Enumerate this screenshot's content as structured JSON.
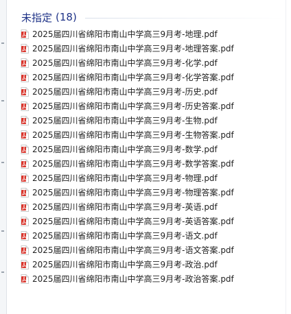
{
  "group": {
    "title": "未指定",
    "count": "(18)"
  },
  "files": [
    "2025届四川省绵阳市南山中学高三9月考-地理.pdf",
    "2025届四川省绵阳市南山中学高三9月考-地理答案.pdf",
    "2025届四川省绵阳市南山中学高三9月考-化学.pdf",
    "2025届四川省绵阳市南山中学高三9月考-化学答案.pdf",
    "2025届四川省绵阳市南山中学高三9月考-历史.pdf",
    "2025届四川省绵阳市南山中学高三9月考-历史答案.pdf",
    "2025届四川省绵阳市南山中学高三9月考-生物.pdf",
    "2025届四川省绵阳市南山中学高三9月考-生物答案.pdf",
    "2025届四川省绵阳市南山中学高三9月考-数学.pdf",
    "2025届四川省绵阳市南山中学高三9月考-数学答案.pdf",
    "2025届四川省绵阳市南山中学高三9月考-物理.pdf",
    "2025届四川省绵阳市南山中学高三9月考-物理答案.pdf",
    "2025届四川省绵阳市南山中学高三9月考-英语.pdf",
    "2025届四川省绵阳市南山中学高三9月考-英语答案.pdf",
    "2025届四川省绵阳市南山中学高三9月考-语文.pdf",
    "2025届四川省绵阳市南山中学高三9月考-语文答案.pdf",
    "2025届四川省绵阳市南山中学高三9月考-政治.pdf",
    "2025届四川省绵阳市南山中学高三9月考-政治答案.pdf"
  ],
  "icons": {
    "file_icon": "pdf-icon"
  },
  "colors": {
    "group_title": "#1e3287",
    "pdf_red": "#d9342b",
    "text": "#1f1f1f"
  }
}
